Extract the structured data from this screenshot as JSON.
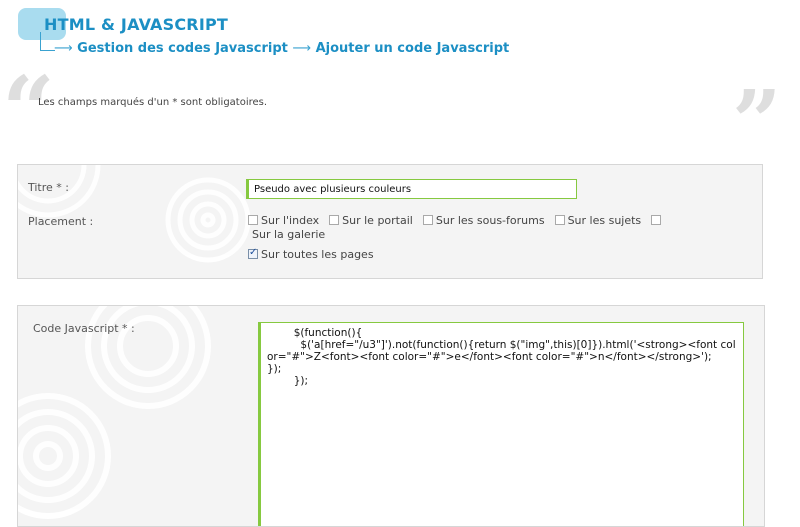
{
  "header": {
    "title": "HTML & JAVASCRIPT",
    "breadcrumb": {
      "arrow": "⟶",
      "item1": "Gestion des codes Javascript",
      "item2": "Ajouter un code Javascript"
    }
  },
  "quotes": {
    "open": "“",
    "close": "”"
  },
  "note": "Les champs marqués d'un * sont obligatoires.",
  "form": {
    "title_label": "Titre * :",
    "title_value": "Pseudo avec plusieurs couleurs",
    "placement_label": "Placement :",
    "placement_options": [
      {
        "label": "Sur l'index",
        "checked": false
      },
      {
        "label": "Sur le portail",
        "checked": false
      },
      {
        "label": "Sur les sous-forums",
        "checked": false
      },
      {
        "label": "Sur les sujets",
        "checked": false
      },
      {
        "label": "Sur la galerie",
        "checked": false
      },
      {
        "label": "Sur toutes les pages",
        "checked": true
      }
    ],
    "code_label": "Code Javascript * :",
    "code_lines": [
      "        $(function(){",
      "          $('a[href=\"/u3\"]').not(function(){return $(\"img\",this)[0]}).html('<strong><font color=\"#\">Z<font><font color=\"#\">e</font><font color=\"#\">n</font></strong>');",
      "});",
      "        });"
    ]
  },
  "colors": {
    "accent_blue": "#1c8fc4",
    "title_bg": "#a9dcef",
    "field_border_green": "#86c940",
    "panel_bg": "#f4f4f4"
  }
}
